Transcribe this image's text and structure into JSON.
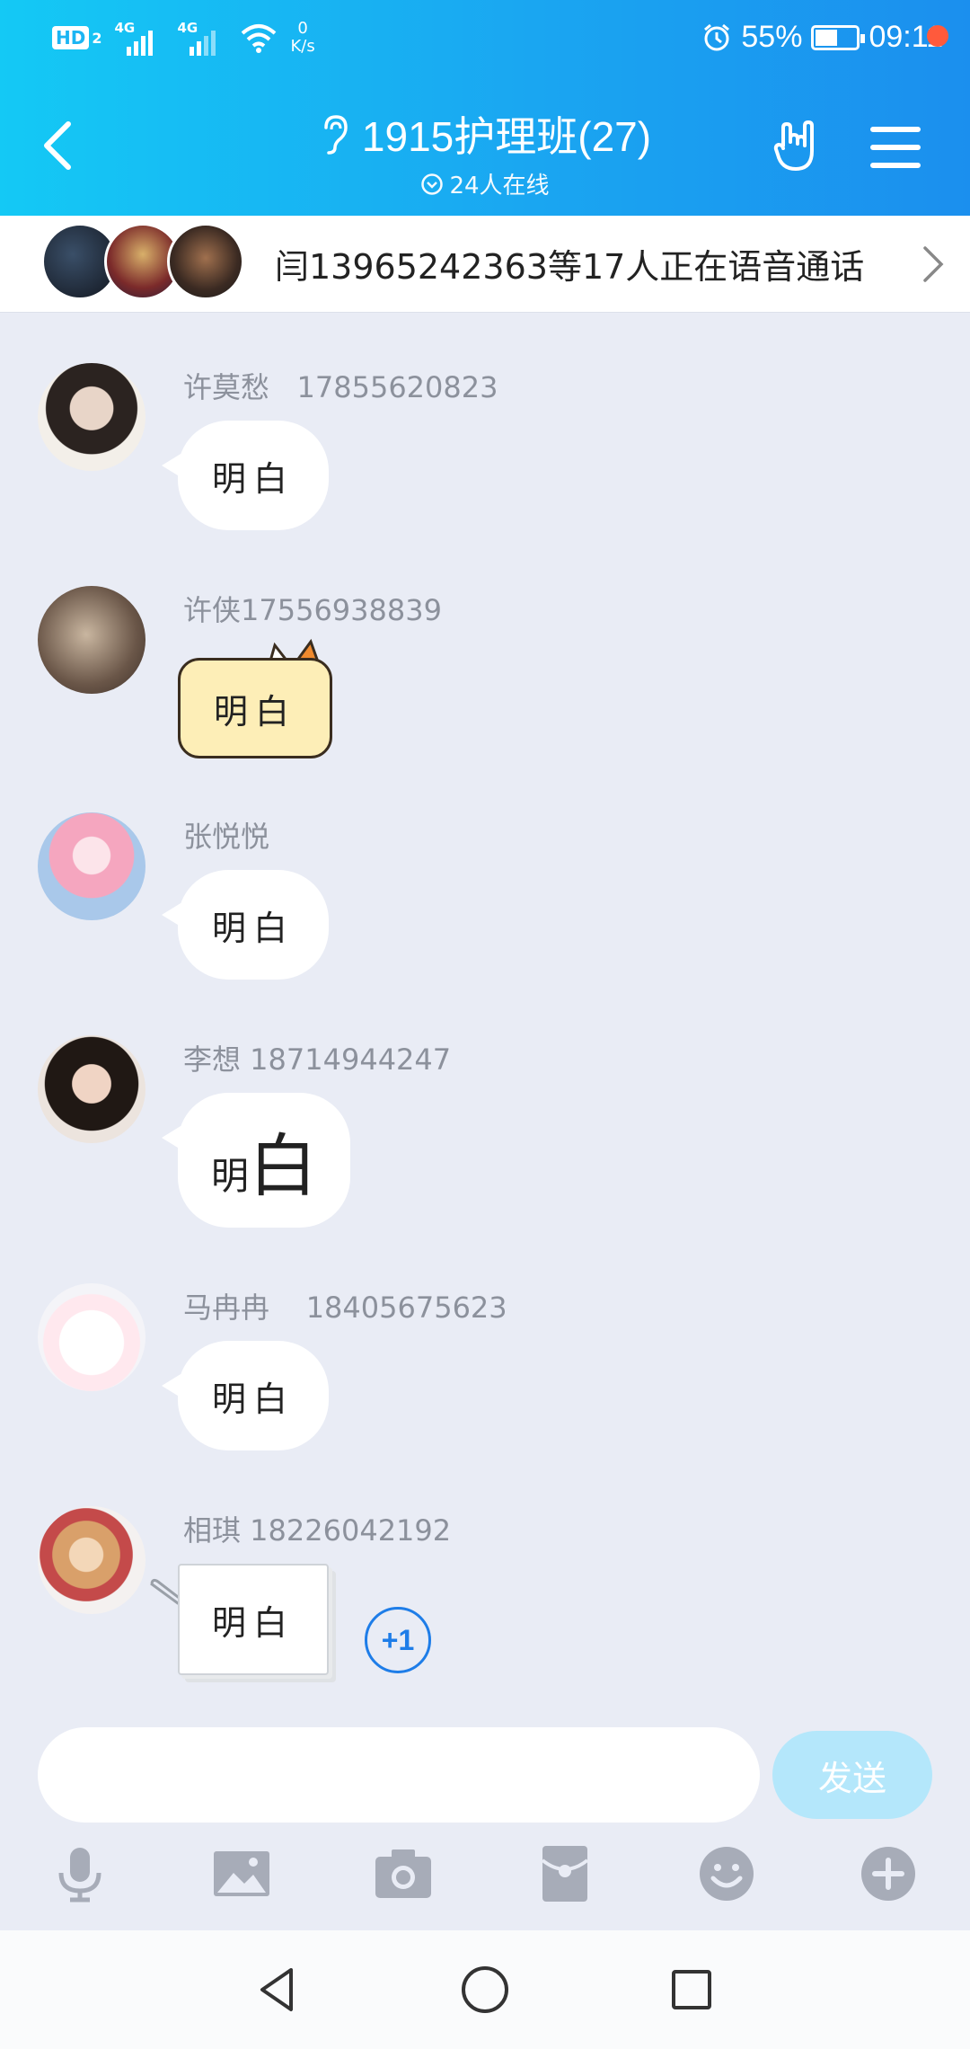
{
  "status_bar": {
    "network_badge": "HD",
    "network_badge_sub": "2",
    "signal1_label": "4G",
    "signal2_label": "4G",
    "speed_value": "0",
    "speed_unit": "K/s",
    "battery_percent": "55%",
    "battery_level": 0.55,
    "time": "09:11"
  },
  "header": {
    "title": "1915护理班(27)",
    "online_text": "24人在线"
  },
  "call_banner": {
    "text": "闫13965242363等17人正在语音通话"
  },
  "messages": [
    {
      "sender": "许莫愁   17855620823",
      "text": "明白"
    },
    {
      "sender": "许侠17556938839",
      "text": "明白"
    },
    {
      "sender": "张悦悦",
      "text": "明白"
    },
    {
      "sender": "李想 18714944247",
      "text_small": "明",
      "text_large": "白"
    },
    {
      "sender": "马冉冉    18405675623",
      "text": "明白"
    },
    {
      "sender": "相琪 18226042192",
      "text": "明白",
      "plus_one": "+1"
    }
  ],
  "input": {
    "value": "",
    "placeholder": "",
    "send_label": "发送"
  },
  "colors": {
    "header_start": "#14c9f5",
    "header_end": "#1b8fee",
    "chat_bg": "#e9ecf5",
    "send_disabled": "#b4e7fb",
    "accent": "#1e7de8",
    "badge_red": "#ff5a3c"
  },
  "icons": {
    "toolbar": [
      "microphone-icon",
      "image-icon",
      "camera-icon",
      "red-packet-icon",
      "emoji-icon",
      "plus-icon"
    ],
    "nav": [
      "back-triangle-icon",
      "home-circle-icon",
      "recents-square-icon"
    ]
  }
}
